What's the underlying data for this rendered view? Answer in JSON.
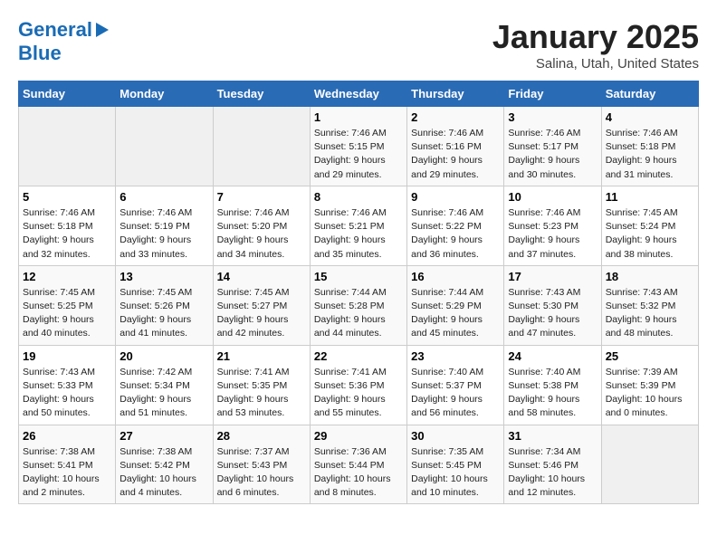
{
  "header": {
    "logo_general": "General",
    "logo_blue": "Blue",
    "title": "January 2025",
    "subtitle": "Salina, Utah, United States"
  },
  "weekdays": [
    "Sunday",
    "Monday",
    "Tuesday",
    "Wednesday",
    "Thursday",
    "Friday",
    "Saturday"
  ],
  "weeks": [
    [
      {
        "day": "",
        "sunrise": "",
        "sunset": "",
        "daylight": "",
        "empty": true
      },
      {
        "day": "",
        "sunrise": "",
        "sunset": "",
        "daylight": "",
        "empty": true
      },
      {
        "day": "",
        "sunrise": "",
        "sunset": "",
        "daylight": "",
        "empty": true
      },
      {
        "day": "1",
        "sunrise": "Sunrise: 7:46 AM",
        "sunset": "Sunset: 5:15 PM",
        "daylight": "Daylight: 9 hours and 29 minutes."
      },
      {
        "day": "2",
        "sunrise": "Sunrise: 7:46 AM",
        "sunset": "Sunset: 5:16 PM",
        "daylight": "Daylight: 9 hours and 29 minutes."
      },
      {
        "day": "3",
        "sunrise": "Sunrise: 7:46 AM",
        "sunset": "Sunset: 5:17 PM",
        "daylight": "Daylight: 9 hours and 30 minutes."
      },
      {
        "day": "4",
        "sunrise": "Sunrise: 7:46 AM",
        "sunset": "Sunset: 5:18 PM",
        "daylight": "Daylight: 9 hours and 31 minutes."
      }
    ],
    [
      {
        "day": "5",
        "sunrise": "Sunrise: 7:46 AM",
        "sunset": "Sunset: 5:18 PM",
        "daylight": "Daylight: 9 hours and 32 minutes."
      },
      {
        "day": "6",
        "sunrise": "Sunrise: 7:46 AM",
        "sunset": "Sunset: 5:19 PM",
        "daylight": "Daylight: 9 hours and 33 minutes."
      },
      {
        "day": "7",
        "sunrise": "Sunrise: 7:46 AM",
        "sunset": "Sunset: 5:20 PM",
        "daylight": "Daylight: 9 hours and 34 minutes."
      },
      {
        "day": "8",
        "sunrise": "Sunrise: 7:46 AM",
        "sunset": "Sunset: 5:21 PM",
        "daylight": "Daylight: 9 hours and 35 minutes."
      },
      {
        "day": "9",
        "sunrise": "Sunrise: 7:46 AM",
        "sunset": "Sunset: 5:22 PM",
        "daylight": "Daylight: 9 hours and 36 minutes."
      },
      {
        "day": "10",
        "sunrise": "Sunrise: 7:46 AM",
        "sunset": "Sunset: 5:23 PM",
        "daylight": "Daylight: 9 hours and 37 minutes."
      },
      {
        "day": "11",
        "sunrise": "Sunrise: 7:45 AM",
        "sunset": "Sunset: 5:24 PM",
        "daylight": "Daylight: 9 hours and 38 minutes."
      }
    ],
    [
      {
        "day": "12",
        "sunrise": "Sunrise: 7:45 AM",
        "sunset": "Sunset: 5:25 PM",
        "daylight": "Daylight: 9 hours and 40 minutes."
      },
      {
        "day": "13",
        "sunrise": "Sunrise: 7:45 AM",
        "sunset": "Sunset: 5:26 PM",
        "daylight": "Daylight: 9 hours and 41 minutes."
      },
      {
        "day": "14",
        "sunrise": "Sunrise: 7:45 AM",
        "sunset": "Sunset: 5:27 PM",
        "daylight": "Daylight: 9 hours and 42 minutes."
      },
      {
        "day": "15",
        "sunrise": "Sunrise: 7:44 AM",
        "sunset": "Sunset: 5:28 PM",
        "daylight": "Daylight: 9 hours and 44 minutes."
      },
      {
        "day": "16",
        "sunrise": "Sunrise: 7:44 AM",
        "sunset": "Sunset: 5:29 PM",
        "daylight": "Daylight: 9 hours and 45 minutes."
      },
      {
        "day": "17",
        "sunrise": "Sunrise: 7:43 AM",
        "sunset": "Sunset: 5:30 PM",
        "daylight": "Daylight: 9 hours and 47 minutes."
      },
      {
        "day": "18",
        "sunrise": "Sunrise: 7:43 AM",
        "sunset": "Sunset: 5:32 PM",
        "daylight": "Daylight: 9 hours and 48 minutes."
      }
    ],
    [
      {
        "day": "19",
        "sunrise": "Sunrise: 7:43 AM",
        "sunset": "Sunset: 5:33 PM",
        "daylight": "Daylight: 9 hours and 50 minutes."
      },
      {
        "day": "20",
        "sunrise": "Sunrise: 7:42 AM",
        "sunset": "Sunset: 5:34 PM",
        "daylight": "Daylight: 9 hours and 51 minutes."
      },
      {
        "day": "21",
        "sunrise": "Sunrise: 7:41 AM",
        "sunset": "Sunset: 5:35 PM",
        "daylight": "Daylight: 9 hours and 53 minutes."
      },
      {
        "day": "22",
        "sunrise": "Sunrise: 7:41 AM",
        "sunset": "Sunset: 5:36 PM",
        "daylight": "Daylight: 9 hours and 55 minutes."
      },
      {
        "day": "23",
        "sunrise": "Sunrise: 7:40 AM",
        "sunset": "Sunset: 5:37 PM",
        "daylight": "Daylight: 9 hours and 56 minutes."
      },
      {
        "day": "24",
        "sunrise": "Sunrise: 7:40 AM",
        "sunset": "Sunset: 5:38 PM",
        "daylight": "Daylight: 9 hours and 58 minutes."
      },
      {
        "day": "25",
        "sunrise": "Sunrise: 7:39 AM",
        "sunset": "Sunset: 5:39 PM",
        "daylight": "Daylight: 10 hours and 0 minutes."
      }
    ],
    [
      {
        "day": "26",
        "sunrise": "Sunrise: 7:38 AM",
        "sunset": "Sunset: 5:41 PM",
        "daylight": "Daylight: 10 hours and 2 minutes."
      },
      {
        "day": "27",
        "sunrise": "Sunrise: 7:38 AM",
        "sunset": "Sunset: 5:42 PM",
        "daylight": "Daylight: 10 hours and 4 minutes."
      },
      {
        "day": "28",
        "sunrise": "Sunrise: 7:37 AM",
        "sunset": "Sunset: 5:43 PM",
        "daylight": "Daylight: 10 hours and 6 minutes."
      },
      {
        "day": "29",
        "sunrise": "Sunrise: 7:36 AM",
        "sunset": "Sunset: 5:44 PM",
        "daylight": "Daylight: 10 hours and 8 minutes."
      },
      {
        "day": "30",
        "sunrise": "Sunrise: 7:35 AM",
        "sunset": "Sunset: 5:45 PM",
        "daylight": "Daylight: 10 hours and 10 minutes."
      },
      {
        "day": "31",
        "sunrise": "Sunrise: 7:34 AM",
        "sunset": "Sunset: 5:46 PM",
        "daylight": "Daylight: 10 hours and 12 minutes."
      },
      {
        "day": "",
        "sunrise": "",
        "sunset": "",
        "daylight": "",
        "empty": true
      }
    ]
  ]
}
